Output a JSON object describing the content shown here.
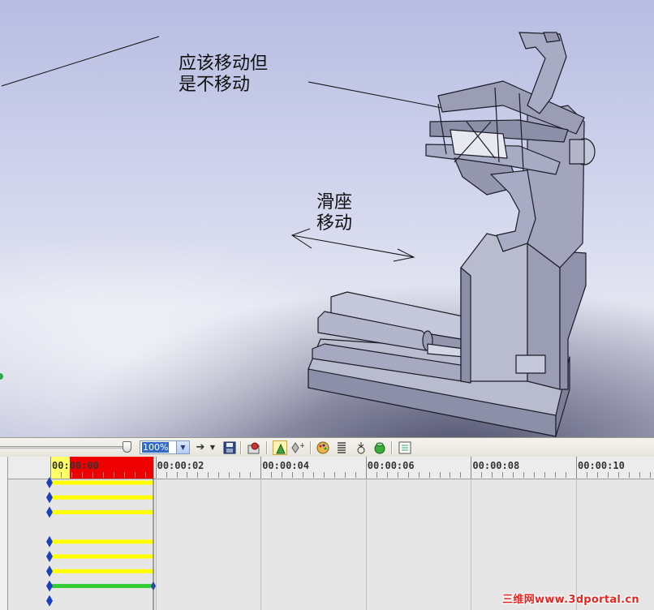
{
  "annotations": {
    "should_move": "应该移动但\n是不移动",
    "slide_move": "滑座\n移动"
  },
  "toolbar": {
    "zoom_value": "100%",
    "icons": [
      "slider-thumb-icon",
      "arrow-right-icon",
      "dropdown-arrow-icon",
      "save-icon",
      "settings-icon",
      "animation-wizard-icon",
      "add-key-icon",
      "palette-icon",
      "spring-icon",
      "gravity-icon",
      "contact-icon",
      "results-icon"
    ]
  },
  "timeline": {
    "ticks": [
      "00:00:00",
      "00:00:02",
      "00:00:04",
      "00:00:06",
      "00:00:08",
      "00:00:10"
    ],
    "tracks": [
      {
        "color": "#ffff00",
        "type": "bar"
      },
      {
        "color": "#ffff00",
        "type": "bar"
      },
      {
        "color": "#ffff00",
        "type": "bar"
      },
      {
        "color": "",
        "type": "empty"
      },
      {
        "color": "#ffff00",
        "type": "bar"
      },
      {
        "color": "#ffff00",
        "type": "bar"
      },
      {
        "color": "#ffff00",
        "type": "bar"
      },
      {
        "color": "#33cc33",
        "type": "bar-end-key"
      },
      {
        "color": "",
        "type": "key-only"
      }
    ],
    "playhead_color": "#ee0000",
    "key_color": "#1a3fbf"
  },
  "watermark": "三维网www.3dportal.cn",
  "colors": {
    "model_face": "#a7abc3",
    "model_edge": "#1c1c28",
    "viewport_top": "#b7bde2"
  }
}
